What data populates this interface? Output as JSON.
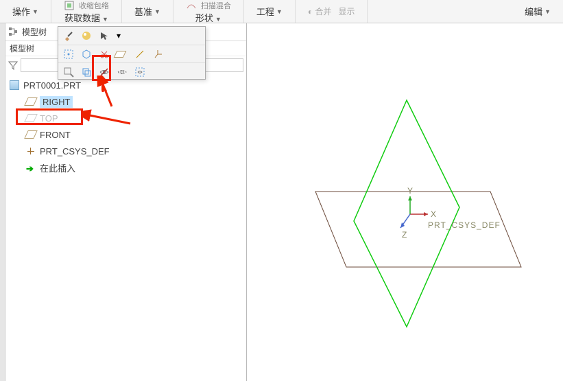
{
  "toolbar": {
    "operate": "操作",
    "get_data": "获取数据",
    "datum": "基准",
    "shape": "形状",
    "engineering": "工程",
    "edit": "编辑",
    "trunc1": "收缩包络",
    "trunc2": "扫描混合",
    "trunc3": "合并",
    "trunc4": "显示"
  },
  "side": {
    "tab_label": "模型树",
    "sub_label": "模型树"
  },
  "search": {
    "placeholder": ""
  },
  "tree": {
    "root": "PRT0001.PRT",
    "items": [
      {
        "label": "RIGHT"
      },
      {
        "label": "TOP"
      },
      {
        "label": "FRONT"
      },
      {
        "label": "PRT_CSYS_DEF"
      },
      {
        "label": "在此插入"
      }
    ]
  },
  "viewport": {
    "csys_label": "PRT_CSYS_DEF",
    "axes": {
      "x": "X",
      "y": "Y",
      "z": "Z"
    }
  }
}
